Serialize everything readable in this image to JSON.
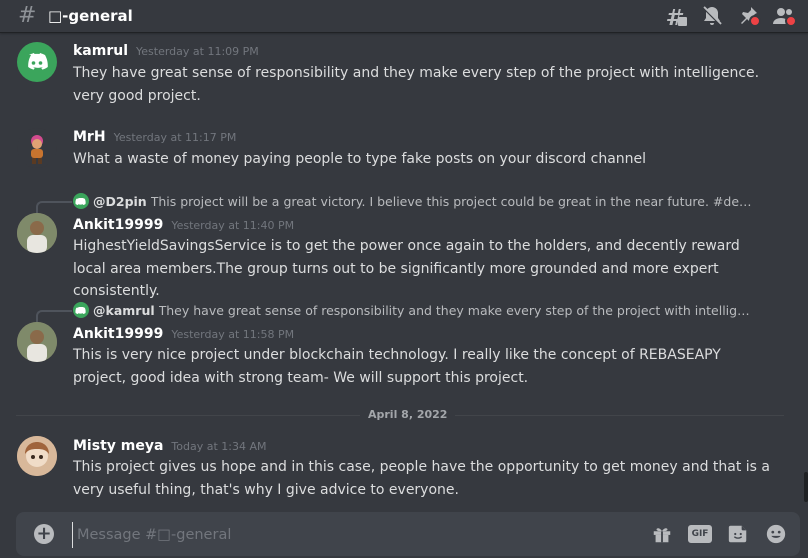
{
  "header": {
    "hash_symbol": "#",
    "channel_name": "□-general",
    "icons": [
      "threads-icon",
      "mute-bell-icon",
      "pin-icon",
      "members-icon"
    ]
  },
  "messages": [
    {
      "username": "kamrul",
      "timestamp": "Yesterday at 11:09 PM",
      "text": "They have great sense of responsibility and they make every step of the project with intelligence. very good project.",
      "avatar": "discord-default-green"
    },
    {
      "username": "MrH",
      "timestamp": "Yesterday at 11:17 PM",
      "text": "What a waste of money paying people to type fake posts on your discord channel",
      "avatar": "cartoon-character"
    },
    {
      "username": "Ankit19999",
      "timestamp": "Yesterday at 11:40 PM",
      "text": "HighestYieldSavingsService is to get the power once again to the holders, and decently reward local area members.The group turns out to be significantly more grounded and more expert consistently.",
      "reply": {
        "user": "@D2pin",
        "text": "This project will be a great victory.  I believe this project could be great in the near future. #defiyield #D..."
      },
      "avatar": "user-photo"
    },
    {
      "username": "Ankit19999",
      "timestamp": "Yesterday at 11:58 PM",
      "text": "This is  very nice project under blockchain technology. I really like the concept of REBASEAPY project, good idea with strong team- We will support this project.",
      "reply": {
        "user": "@kamrul",
        "text": "They have great sense of responsibility and they make every step of the project with intelligence. very ..."
      },
      "avatar": "user-photo"
    },
    {
      "username": "Misty meya",
      "timestamp": "Today at 1:34 AM",
      "text": "This project gives us hope and in this case, people have the opportunity to get money and that is a very useful thing, that's why I give advice to everyone.",
      "avatar": "doll-photo"
    }
  ],
  "date_divider": "April 8, 2022",
  "composer": {
    "add_symbol": "+",
    "placeholder": "Message #□-general",
    "gif_label": "GIF",
    "icons": [
      "gift-icon",
      "gif-icon",
      "sticker-icon",
      "emoji-icon"
    ]
  },
  "colors": {
    "background": "#36393f",
    "composer_bg": "#40444b",
    "discord_green": "#3ba55c",
    "notification_red": "#ed4245",
    "username_white": "#ffffff",
    "timestamp_gray": "#72767d"
  }
}
